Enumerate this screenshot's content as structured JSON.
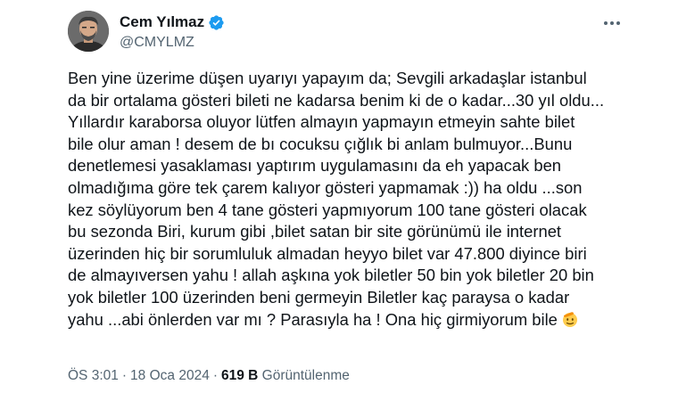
{
  "author": {
    "display_name": "Cem Yılmaz",
    "handle": "@CMYLMZ",
    "verified": true,
    "verified_color": "#1d9bf0"
  },
  "menu": {
    "icon": "more-horizontal-icon"
  },
  "tweet": {
    "lines": [
      "Ben yine üzerime düşen uyarıyı yapayım da; Sevgili arkadaşlar istanbul",
      "da bir ortalama gösteri bileti ne kadarsa benim ki de o kadar...30 yıl oldu...",
      "Yıllardır karaborsa oluyor lütfen almayın yapmayın etmeyin sahte bilet",
      "bile olur aman ! desem de bı cocuksu çığlık bi anlam bulmuyor...Bunu",
      "denetlemesi yasaklaması yaptırım uygulamasını da eh yapacak ben",
      "olmadığıma göre tek çarem kalıyor gösteri yapmamak :)) ha oldu ...son",
      "kez söylüyorum ben 4 tane gösteri yapmıyorum 100 tane gösteri olacak",
      "bu sezonda Biri,  kurum gibi ,bilet satan bir site görünümü ile internet",
      "üzerinden hiç bir sorumluluk almadan heyyo bilet var 47.800 diyince biri",
      "de almayıversen yahu !  allah aşkına yok biletler 50 bin yok biletler 20 bin",
      "yok biletler 100 üzerinden beni germeyin Biletler kaç paraysa o kadar",
      "yahu ...abi önlerden var mı ? Parasıyla ha ! Ona hiç girmiyorum bile"
    ],
    "trailing_emoji": "saluting-face-emoji"
  },
  "meta": {
    "time": "ÖS 3:01",
    "separator": "·",
    "date": "18 Oca 2024",
    "views_count": "619 B",
    "views_label": "Görüntülenme"
  }
}
